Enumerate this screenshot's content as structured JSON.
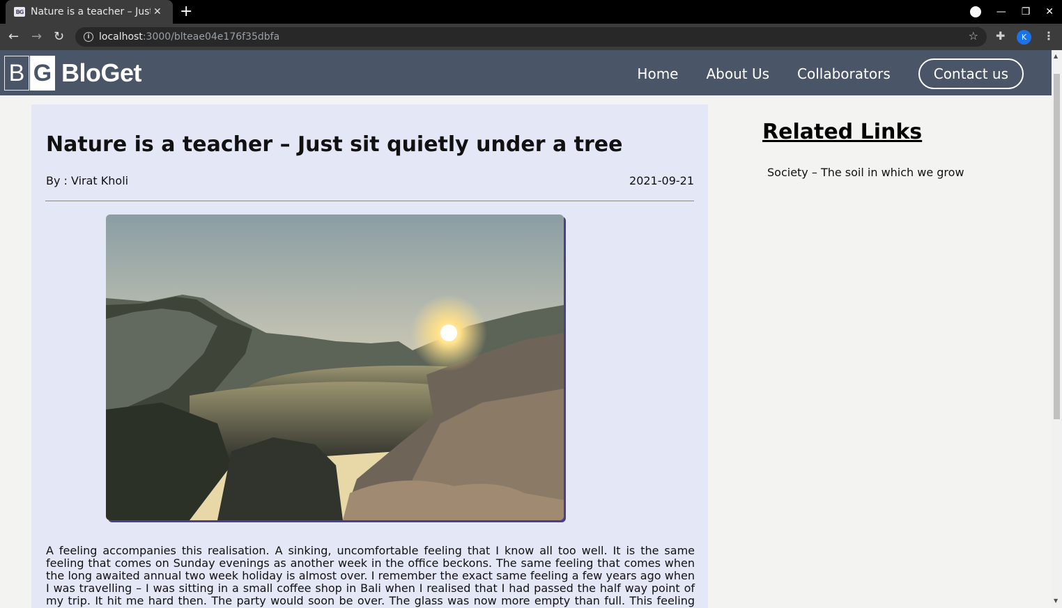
{
  "browser": {
    "tab_title": "Nature is a teacher – Just",
    "favicon_text": "BG",
    "url_host": "localhost",
    "url_path": ":3000/blteae04e176f35dbfa",
    "profile_initial": "K"
  },
  "site": {
    "logo_b": "B",
    "logo_g": "G",
    "logo_text": "BloGet",
    "nav": {
      "home": "Home",
      "about": "About Us",
      "collaborators": "Collaborators",
      "contact": "Contact us"
    }
  },
  "article": {
    "title": "Nature is a teacher – Just sit quietly under a tree",
    "byline": "By : Virat Kholi",
    "date": "2021-09-21",
    "body": "A feeling accompanies this realisation. A sinking, uncomfortable feeling that I know all too well. It is the same feeling that comes on Sunday evenings as another week in the office beckons. The same feeling that comes when the long awaited annual two week holiday is almost over. I remember the exact same feeling a few years ago when I was travelling – I was sitting in a small coffee shop in Bali when I realised that I had passed the half way point of my trip. It hit me hard then. The party would soon be over. The glass was now more empty than full. This feeling has been with me in one way or another for most of my adult life."
  },
  "sidebar": {
    "title": "Related Links",
    "links": [
      "Society – The soil in which we grow"
    ]
  }
}
